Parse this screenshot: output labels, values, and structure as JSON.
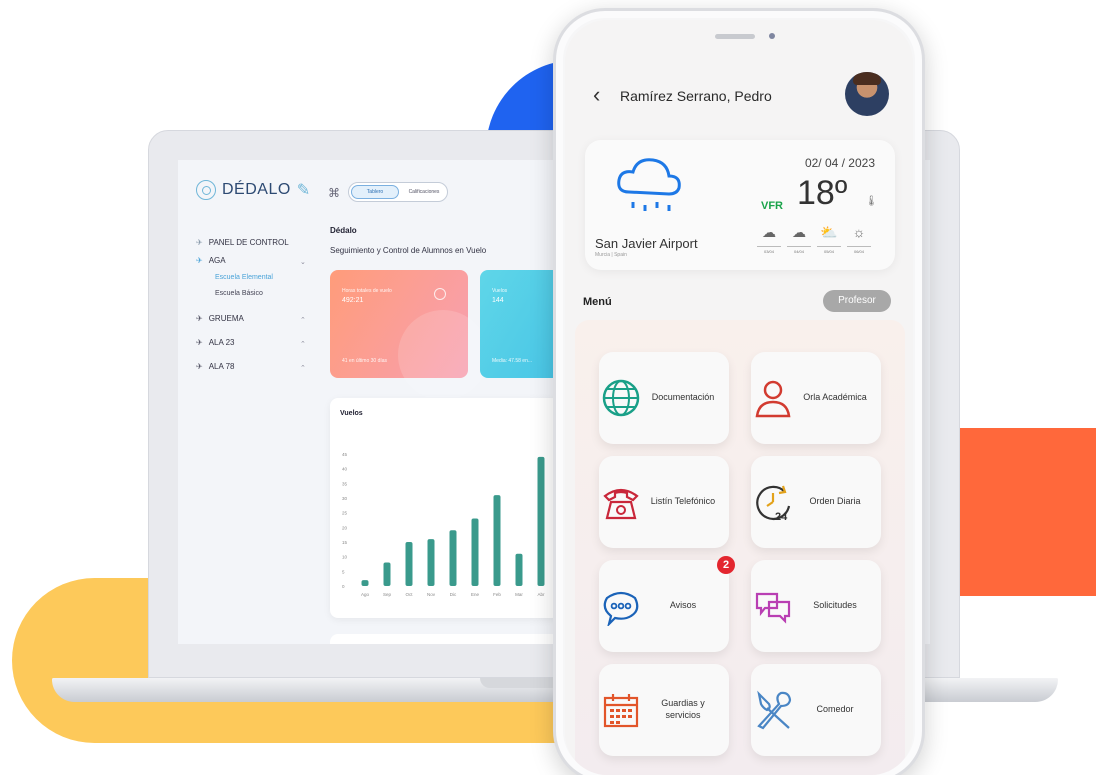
{
  "laptop": {
    "logo": "DÉDALO",
    "toggle": [
      "Tablero",
      "Calificaciones"
    ],
    "sidebar": {
      "panel": "PANEL DE CONTROL",
      "aga": "AGA",
      "aga_sub": [
        "Escuela Elemental",
        "Escuela Básico"
      ],
      "items": [
        "GRUEMA",
        "ALA 23",
        "ALA 78"
      ]
    },
    "title": "Dédalo",
    "subtitle": "Seguimiento y Control de Alumnos en Vuelo",
    "kpi1": {
      "label": "Horas totales de vuelo",
      "value": "492:21",
      "footer": "41 en último 30 días"
    },
    "kpi2": {
      "label": "Vuelos",
      "value": "144",
      "footer": "Media: 47.58 en..."
    }
  },
  "chart_data": {
    "type": "bar",
    "title": "Vuelos",
    "categories": [
      "Ago",
      "Sep",
      "Oct",
      "Nov",
      "Dic",
      "Ene",
      "Feb",
      "Mar",
      "Abr"
    ],
    "values": [
      2,
      8,
      15,
      16,
      19,
      23,
      31,
      11,
      44
    ],
    "yticks": [
      0,
      5,
      10,
      15,
      20,
      25,
      30,
      35,
      40,
      45
    ],
    "ylim": [
      0,
      45
    ],
    "color": "#3a9a8c"
  },
  "phone": {
    "user_name": "Ramírez Serrano, Pedro",
    "weather": {
      "date": "02/ 04 / 2023",
      "vfr": "VFR",
      "temp": "18º",
      "airport": "San Javier Airport",
      "region": "Murcia | Spain",
      "forecast": [
        {
          "icon": "rain-cloud-icon",
          "glyph": "☁",
          "date": "03/04"
        },
        {
          "icon": "wind-cloud-icon",
          "glyph": "☁",
          "date": "04/04"
        },
        {
          "icon": "sun-rain-icon",
          "glyph": "⛅",
          "date": "05/04"
        },
        {
          "icon": "sun-icon",
          "glyph": "☼",
          "date": "06/04"
        }
      ]
    },
    "menu_label": "Menú",
    "role": "Profesor",
    "tiles": {
      "doc": "Documentación",
      "orla": "Orla Académica",
      "listin": "Listín Telefónico",
      "orden": "Orden Diaria",
      "avisos": "Avisos",
      "avisos_badge": "2",
      "solicitudes": "Solicitudes",
      "guardias": "Guardias y servicios",
      "comedor": "Comedor"
    }
  }
}
